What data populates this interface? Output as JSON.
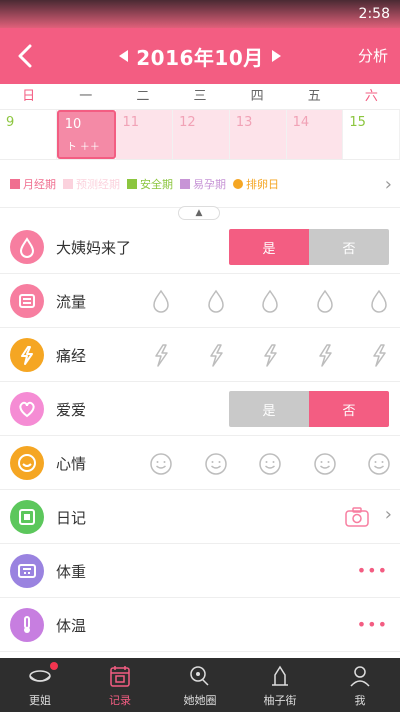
{
  "status": {
    "time": "2:58"
  },
  "header": {
    "title": "2016年10月",
    "right_action": "分析"
  },
  "weekdays": [
    "日",
    "一",
    "二",
    "三",
    "四",
    "五",
    "六"
  ],
  "days": [
    {
      "num": "9",
      "style": "green",
      "sub": ""
    },
    {
      "num": "10",
      "style": "today",
      "sub": "ト ＋＋"
    },
    {
      "num": "11",
      "style": "pink",
      "sub": ""
    },
    {
      "num": "12",
      "style": "pink",
      "sub": ""
    },
    {
      "num": "13",
      "style": "pink",
      "sub": ""
    },
    {
      "num": "14",
      "style": "pink",
      "sub": ""
    },
    {
      "num": "15",
      "style": "green",
      "sub": ""
    }
  ],
  "legend": {
    "items": [
      {
        "label": "月经期",
        "color": "#f06f90",
        "shape": "square"
      },
      {
        "label": "预测经期",
        "color": "#fbd2dd",
        "shape": "square"
      },
      {
        "label": "安全期",
        "color": "#8cc63f",
        "shape": "square"
      },
      {
        "label": "易孕期",
        "color": "#c794d6",
        "shape": "square"
      },
      {
        "label": "排卵日",
        "color": "#f5a623",
        "shape": "dot"
      }
    ]
  },
  "rows": [
    {
      "label": "大姨妈来了",
      "icon_color": "#f77ea0",
      "icon": "drop-icon",
      "control": "toggle",
      "yes": "是",
      "no": "否",
      "selected": "yes"
    },
    {
      "label": "流量",
      "icon_color": "#f77ea0",
      "icon": "flow-icon",
      "control": "drops"
    },
    {
      "label": "痛经",
      "icon_color": "#f5a623",
      "icon": "pain-icon",
      "control": "bolts"
    },
    {
      "label": "爱爱",
      "icon_color": "#f58cd4",
      "icon": "heart-icon",
      "control": "toggle",
      "yes": "是",
      "no": "否",
      "selected": "no"
    },
    {
      "label": "心情",
      "icon_color": "#f5a623",
      "icon": "smile-icon",
      "control": "faces"
    },
    {
      "label": "日记",
      "icon_color": "#5cc75c",
      "icon": "diary-icon",
      "control": "camera"
    },
    {
      "label": "体重",
      "icon_color": "#9a83e0",
      "icon": "scale-icon",
      "control": "more"
    },
    {
      "label": "体温",
      "icon_color": "#c77ee0",
      "icon": "thermometer-icon",
      "control": "more"
    }
  ],
  "more_glyph": "•••",
  "tabs": [
    {
      "label": "更姐",
      "icon": "cup-icon",
      "badge": true,
      "active": false
    },
    {
      "label": "记录",
      "icon": "calendar-icon",
      "badge": false,
      "active": true
    },
    {
      "label": "她她圈",
      "icon": "chat-icon",
      "badge": false,
      "active": false
    },
    {
      "label": "柚子街",
      "icon": "shop-icon",
      "badge": false,
      "active": false
    },
    {
      "label": "我",
      "icon": "user-icon",
      "badge": false,
      "active": false
    }
  ],
  "colors": {
    "brand": "#f35d82",
    "tabbar": "#2e2e2e"
  }
}
